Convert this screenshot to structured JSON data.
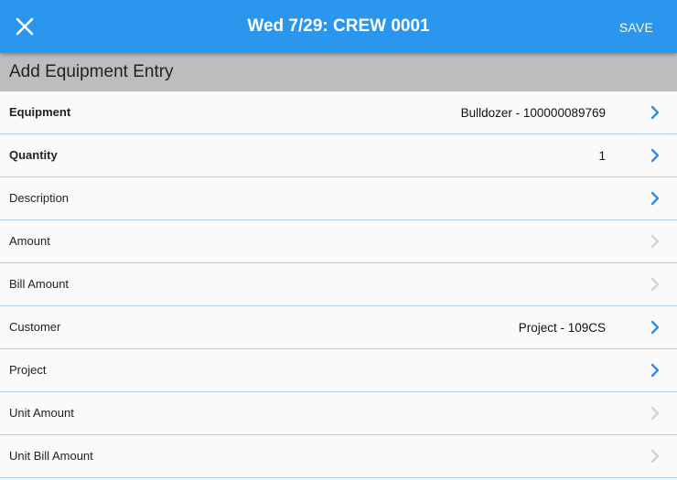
{
  "header": {
    "title": "Wed 7/29: CREW 0001",
    "save_label": "SAVE",
    "close_icon": "close-icon"
  },
  "section": {
    "title": "Add Equipment Entry"
  },
  "colors": {
    "accent": "#2b96ee",
    "chevron_active": "#2b8fe6",
    "chevron_disabled": "#d2d2d2",
    "divider": "#aad0ee",
    "section_bg": "#bdbdbd"
  },
  "fields": [
    {
      "label": "Equipment",
      "value": "Bulldozer - 100000089769",
      "bold": true,
      "enabled": true
    },
    {
      "label": "Quantity",
      "value": "1",
      "bold": true,
      "enabled": true
    },
    {
      "label": "Description",
      "value": "",
      "bold": false,
      "enabled": true
    },
    {
      "label": "Amount",
      "value": "",
      "bold": false,
      "enabled": false
    },
    {
      "label": "Bill Amount",
      "value": "",
      "bold": false,
      "enabled": false
    },
    {
      "label": "Customer",
      "value": "Project - 109CS",
      "bold": false,
      "enabled": true
    },
    {
      "label": "Project",
      "value": "",
      "bold": false,
      "enabled": true
    },
    {
      "label": "Unit Amount",
      "value": "",
      "bold": false,
      "enabled": false
    },
    {
      "label": "Unit Bill Amount",
      "value": "",
      "bold": false,
      "enabled": false
    }
  ]
}
